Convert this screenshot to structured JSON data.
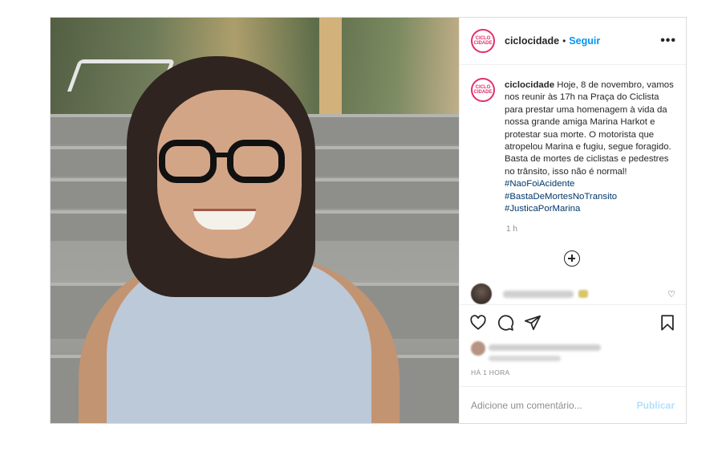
{
  "post": {
    "username": "ciclocidade",
    "separator": "•",
    "follow_label": "Seguir",
    "more_icon": "more-horizontal-icon",
    "avatar_text": "CICLO CIDADE"
  },
  "caption": {
    "username": "ciclocidade",
    "text": "Hoje, 8 de novembro, vamos nos reunir às 17h na Praça do Ciclista para prestar uma homenagem à vida da nossa grande amiga Marina Harkot e protestar sua morte. O motorista que atropelou Marina e fugiu, segue foragido. Basta de mortes de ciclistas e pedestres no trânsito, isso não é normal!",
    "hashtags": [
      "#NaoFoiAcidente",
      "#BastaDeMortesNoTransito",
      "#JusticaPorMarina"
    ],
    "time": "1 h"
  },
  "actions": {
    "icons": [
      "heart-icon",
      "comment-icon",
      "share-icon",
      "bookmark-icon"
    ]
  },
  "footer": {
    "posted_ago": "HÁ 1 HORA",
    "comment_placeholder": "Adicione um comentário...",
    "publish_label": "Publicar"
  }
}
